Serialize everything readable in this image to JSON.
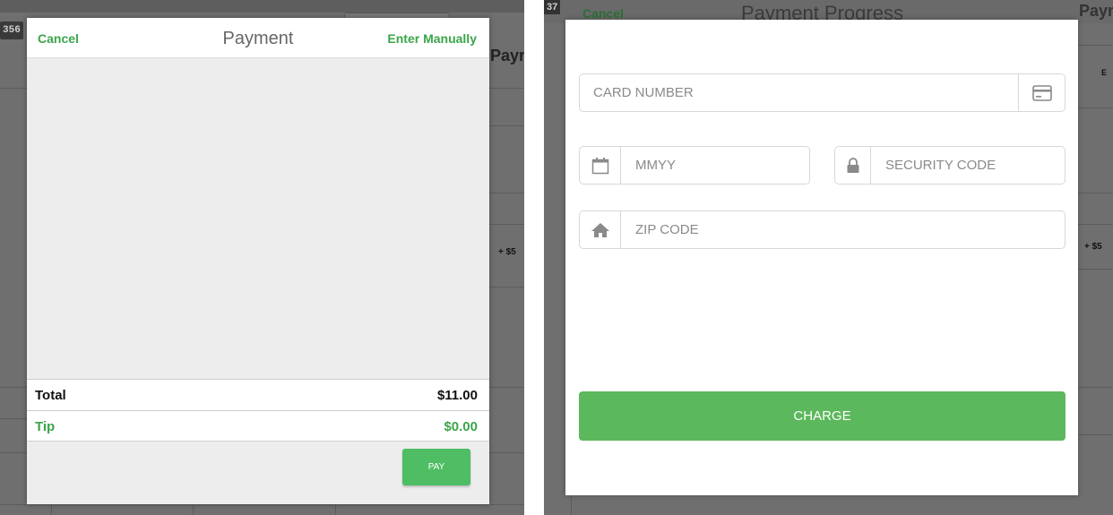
{
  "left_screen": {
    "background": {
      "chip_text": "356",
      "side_tab_text": "Payr",
      "side_small_text": "+ $5"
    },
    "header": {
      "cancel_label": "Cancel",
      "title": "Payment",
      "enter_manually_label": "Enter Manually"
    },
    "summary": {
      "total_label": "Total",
      "total_value": "$11.00",
      "tip_label": "Tip",
      "tip_value": "$0.00"
    },
    "pay_button_label": "PAY"
  },
  "right_screen": {
    "background": {
      "chip_text": "37",
      "cancel_label": "Cancel",
      "title": "Payment Progress",
      "side_tab_text": "Payn",
      "side_small_text": "+ $5",
      "side_tiny_text": "E"
    },
    "form": {
      "card_number_placeholder": "CARD NUMBER",
      "expiry_placeholder": "MMYY",
      "security_code_placeholder": "SECURITY CODE",
      "zip_code_placeholder": "ZIP CODE",
      "card_icon": "credit-card-icon",
      "calendar_icon": "calendar-icon",
      "lock_icon": "lock-icon",
      "home_icon": "home-icon"
    },
    "charge_button_label": "CHARGE"
  },
  "colors": {
    "accent_green": "#3aa54a",
    "button_green": "#5cb85c",
    "overlay_gray": "#6f6f6f"
  }
}
